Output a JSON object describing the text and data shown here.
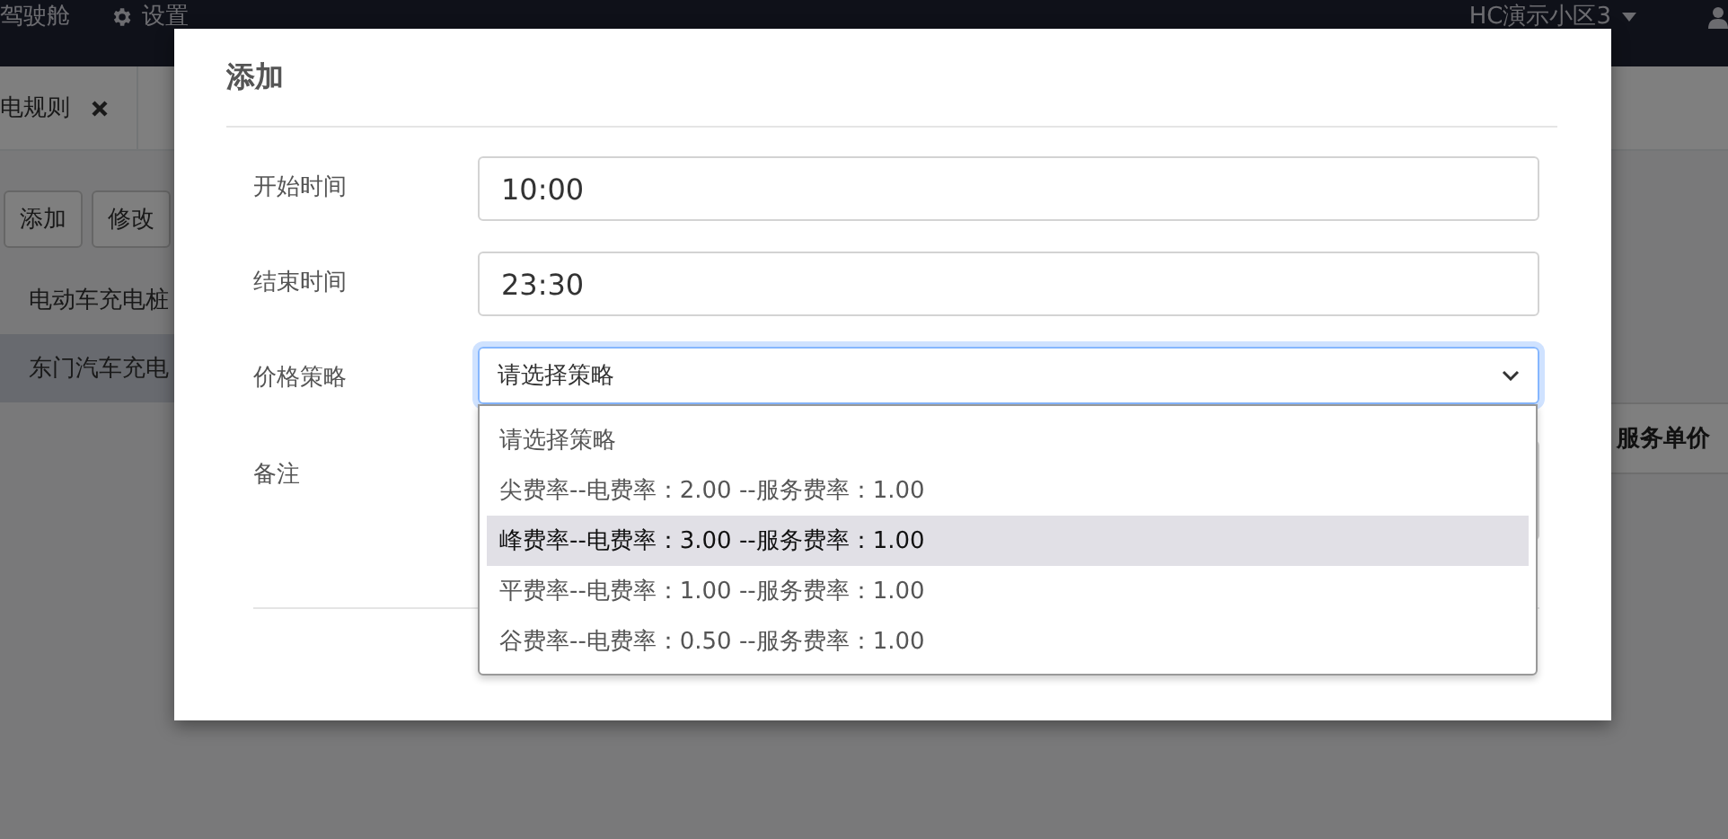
{
  "navbar": {
    "items": [
      {
        "label": "驾驶舱",
        "kind": "text"
      },
      {
        "label": "设置",
        "kind": "gear"
      }
    ],
    "community": "HC演示小区3"
  },
  "tabs": [
    {
      "label": "电规则",
      "selected": true
    }
  ],
  "toolbar": {
    "buttons": [
      "添加",
      "修改"
    ]
  },
  "list": [
    {
      "label": "电动车充电桩",
      "selected": false
    },
    {
      "label": "东门汽车充电",
      "selected": true
    }
  ],
  "table": {
    "column_header": "服务单价"
  },
  "modal": {
    "title": "添加",
    "fields": [
      {
        "label": "开始时间",
        "kind": "input",
        "value": "10:00"
      },
      {
        "label": "结束时间",
        "kind": "input",
        "value": "23:30"
      },
      {
        "label": "价格策略",
        "kind": "select",
        "value": "请选择策略",
        "options": [
          {
            "label": "请选择策略",
            "highlighted": false
          },
          {
            "label": "尖费率--电费率：2.00 --服务费率：1.00",
            "highlighted": false
          },
          {
            "label": "峰费率--电费率：3.00 --服务费率：1.00",
            "highlighted": true
          },
          {
            "label": "平费率--电费率：1.00 --服务费率：1.00",
            "highlighted": false
          },
          {
            "label": "谷费率--电费率：0.50 --服务费率：1.00",
            "highlighted": false
          }
        ]
      },
      {
        "label": "备注",
        "kind": "textarea"
      }
    ]
  }
}
